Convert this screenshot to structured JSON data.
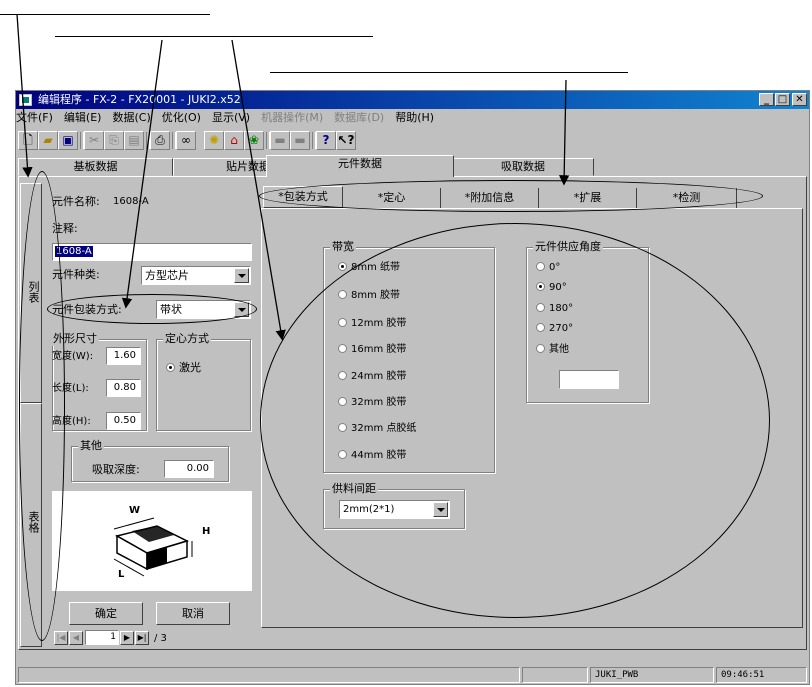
{
  "window": {
    "title": "编辑程序 - FX-2 - FX20001 - JUKI2.x52",
    "controls": [
      "_",
      "□",
      "✕"
    ]
  },
  "menu": [
    "文件(F)",
    "编辑(E)",
    "数据(C)",
    "优化(O)",
    "显示(V)",
    "机器操作(M)",
    "数据库(D)",
    "帮助(H)"
  ],
  "menu_disabled": [
    false,
    false,
    false,
    false,
    false,
    true,
    true,
    false
  ],
  "toolbar_icons": [
    "new-file-icon",
    "open-folder-icon",
    "save-icon",
    "cut-icon",
    "copy-icon",
    "paste-icon",
    "print-icon",
    "find-icon",
    "lightbulb-icon",
    "network-icon",
    "tree-icon",
    "align-left-icon",
    "align-right-icon",
    "help-icon",
    "context-help-icon"
  ],
  "main_tabs": [
    "基板数据",
    "贴片数据",
    "元件数据",
    "吸取数据"
  ],
  "side_tabs": {
    "list": "列表",
    "table": "表格"
  },
  "left": {
    "part_name_label": "元件名称:",
    "part_name_value": "1608-A",
    "comment_label": "注释:",
    "comment_value": "1608-A",
    "part_type_label": "元件种类:",
    "part_type_value": "方型芯片",
    "package_label": "元件包装方式:",
    "package_value": "带状",
    "dim_title": "外形尺寸",
    "width_label": "宽度(W):",
    "width_value": "1.60",
    "length_label": "长度(L):",
    "length_value": "0.80",
    "height_label": "高度(H):",
    "height_value": "0.50",
    "center_title": "定心方式",
    "center_option": "激光",
    "other_title": "其他",
    "pick_depth_label": "吸取深度:",
    "pick_depth_value": "0.00",
    "diagram_w": "W",
    "diagram_h": "H",
    "diagram_l": "L",
    "ok_button": "确定",
    "cancel_button": "取消"
  },
  "pager": {
    "current": "1",
    "total": "/ 3"
  },
  "sub_tabs": [
    "*包装方式",
    "*定心",
    "*附加信息",
    "*扩展",
    "*检测"
  ],
  "tape_width": {
    "title": "带宽",
    "options": [
      "8mm  纸带",
      "8mm  胶带",
      "12mm 胶带",
      "16mm 胶带",
      "24mm 胶带",
      "32mm 胶带",
      "32mm 点胶纸",
      "44mm 胶带"
    ],
    "selected": 0
  },
  "feed_angle": {
    "title": "元件供应角度",
    "options": [
      "0°",
      "90°",
      "180°",
      "270°",
      "其他"
    ],
    "selected": 1,
    "other_value": ""
  },
  "feed_pitch": {
    "title": "供料间距",
    "value": "2mm(2*1)"
  },
  "status": {
    "machine": "JUKI_PWB",
    "time": "09:46:51"
  }
}
